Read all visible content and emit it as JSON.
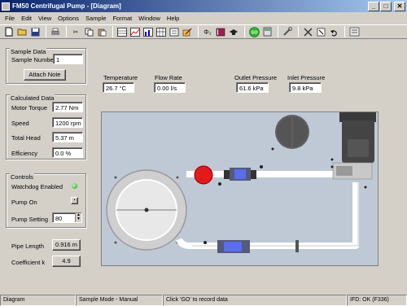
{
  "window": {
    "title": "FM50 Centrifugal Pump - [Diagram]",
    "minimize": "_",
    "maximize": "□",
    "close": "✕"
  },
  "menu": [
    "File",
    "Edit",
    "View",
    "Options",
    "Sample",
    "Format",
    "Window",
    "Help"
  ],
  "toolbar": {
    "icons": [
      "new-icon",
      "open-icon",
      "save-icon",
      "print-icon",
      "cut-icon",
      "copy-icon",
      "paste-icon",
      "table-icon",
      "chart-icon",
      "graph-icon",
      "grid-icon",
      "wizard-icon",
      "edit-icon",
      "phi2-icon",
      "book-icon",
      "help-hat-icon",
      "go-icon",
      "calculator-icon",
      "settings-icon",
      "clear-icon",
      "cross-icon",
      "undo-icon",
      "zoom-icon",
      "data-icon"
    ],
    "phi_label": "Φ₂",
    "go_label": "GO"
  },
  "sample_data": {
    "title": "Sample Data",
    "sample_number_label": "Sample Number",
    "sample_number": "1",
    "attach_note": "Attach Note"
  },
  "calculated_data": {
    "title": "Calculated Data",
    "motor_torque_label": "Motor Torque",
    "motor_torque": "2.77 Nm",
    "speed_label": "Speed",
    "speed": "1200 rpm",
    "total_head_label": "Total Head",
    "total_head": "5.37 m",
    "efficiency_label": "Efficiency",
    "efficiency": "0.0 %"
  },
  "controls": {
    "title": "Controls",
    "watchdog_label": "Watchdog Enabled",
    "pump_on_label": "Pump On",
    "pump_setting_label": "Pump Setting",
    "pump_setting": "80"
  },
  "pipe": {
    "pipe_length_label": "Pipe Length",
    "pipe_length": "0.916 m",
    "coefficient_label": "Coefficient k",
    "coefficient": "4.9"
  },
  "readings": {
    "temperature_label": "Temperature",
    "temperature": "26.7 °C",
    "flow_rate_label": "Flow Rate",
    "flow_rate": "0.00 l/s",
    "outlet_pressure_label": "Outlet Pressure",
    "outlet_pressure": "61.6 kPa",
    "inlet_pressure_label": "Inlet Pressure",
    "inlet_pressure": "9.8 kPa"
  },
  "status": {
    "panel1": "Diagram",
    "panel2": "Sample Mode - Manual",
    "panel3": "Click 'GO' to record data",
    "panel4": "IFD: OK (F336)"
  }
}
